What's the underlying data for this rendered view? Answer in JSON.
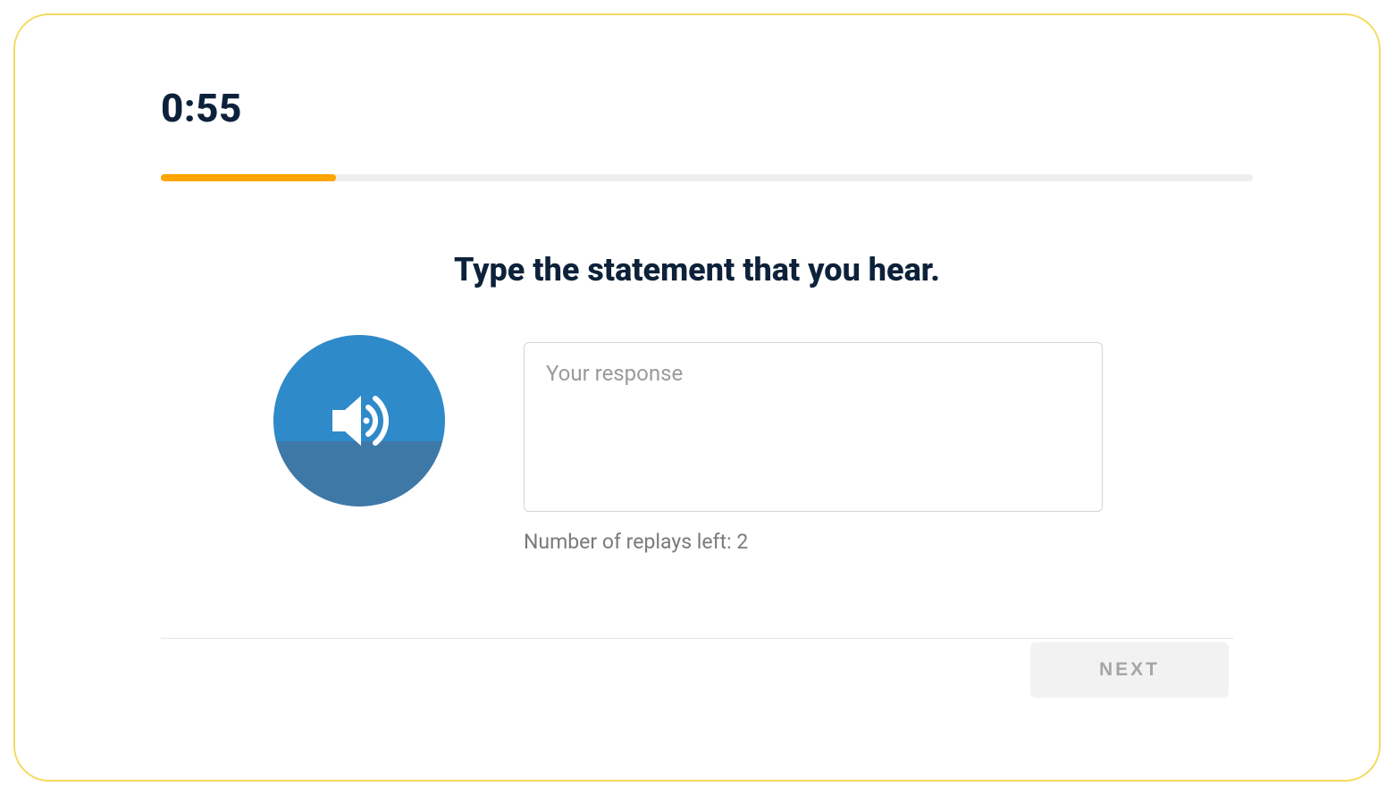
{
  "timer": "0:55",
  "progress_percent": 16,
  "prompt": "Type the statement that you hear.",
  "response": {
    "value": "",
    "placeholder": "Your response"
  },
  "replays_left_text": "Number of replays left: 2",
  "next_button_label": "NEXT",
  "colors": {
    "border": "#f4da5e",
    "progress_fill": "#ffa500",
    "audio_button_top": "#2e8ac9",
    "audio_button_bottom": "#3e78a7",
    "text_dark": "#0d223a",
    "text_muted": "#7a7a7a"
  }
}
